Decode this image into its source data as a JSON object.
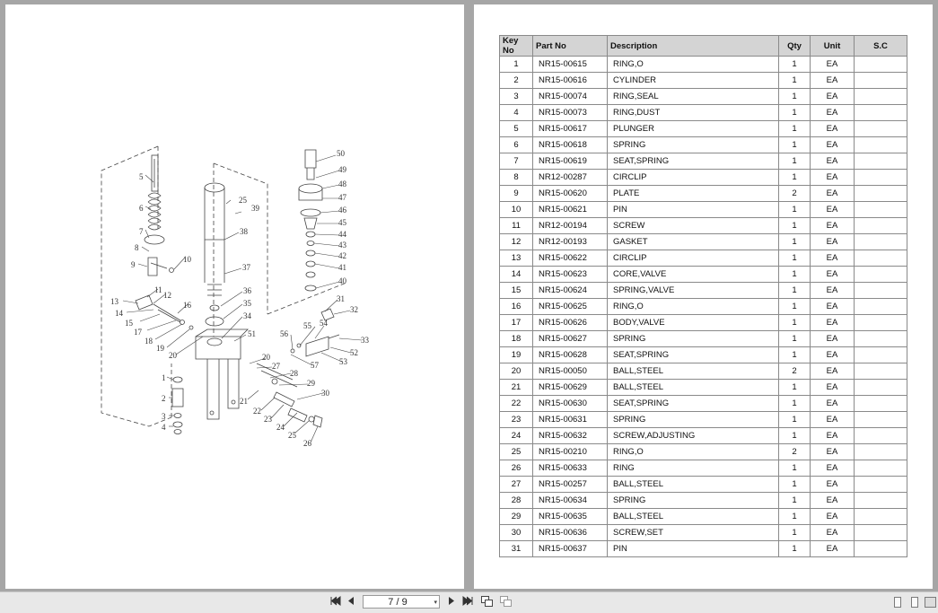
{
  "diagram": {
    "callouts": [
      "1",
      "2",
      "3",
      "4",
      "5",
      "6",
      "7",
      "8",
      "9",
      "10",
      "11",
      "12",
      "13",
      "14",
      "15",
      "16",
      "17",
      "18",
      "19",
      "20",
      "21",
      "22",
      "23",
      "24",
      "25",
      "26",
      "27",
      "28",
      "29",
      "30",
      "31",
      "32",
      "33",
      "34",
      "35",
      "36",
      "37",
      "38",
      "39",
      "40",
      "41",
      "42",
      "43",
      "44",
      "45",
      "46",
      "47",
      "48",
      "49",
      "50",
      "51",
      "52",
      "53",
      "54",
      "55",
      "56",
      "57",
      "20"
    ]
  },
  "table": {
    "headers": [
      "Key No",
      "Part No",
      "Description",
      "Qty",
      "Unit",
      "S.C"
    ],
    "rows": [
      [
        "1",
        "NR15-00615",
        "RING,O",
        "1",
        "EA",
        ""
      ],
      [
        "2",
        "NR15-00616",
        "CYLINDER",
        "1",
        "EA",
        ""
      ],
      [
        "3",
        "NR15-00074",
        "RING,SEAL",
        "1",
        "EA",
        ""
      ],
      [
        "4",
        "NR15-00073",
        "RING,DUST",
        "1",
        "EA",
        ""
      ],
      [
        "5",
        "NR15-00617",
        "PLUNGER",
        "1",
        "EA",
        ""
      ],
      [
        "6",
        "NR15-00618",
        "SPRING",
        "1",
        "EA",
        ""
      ],
      [
        "7",
        "NR15-00619",
        "SEAT,SPRING",
        "1",
        "EA",
        ""
      ],
      [
        "8",
        "NR12-00287",
        "CIRCLIP",
        "1",
        "EA",
        ""
      ],
      [
        "9",
        "NR15-00620",
        "PLATE",
        "2",
        "EA",
        ""
      ],
      [
        "10",
        "NR15-00621",
        "PIN",
        "1",
        "EA",
        ""
      ],
      [
        "11",
        "NR12-00194",
        "SCREW",
        "1",
        "EA",
        ""
      ],
      [
        "12",
        "NR12-00193",
        "GASKET",
        "1",
        "EA",
        ""
      ],
      [
        "13",
        "NR15-00622",
        "CIRCLIP",
        "1",
        "EA",
        ""
      ],
      [
        "14",
        "NR15-00623",
        "CORE,VALVE",
        "1",
        "EA",
        ""
      ],
      [
        "15",
        "NR15-00624",
        "SPRING,VALVE",
        "1",
        "EA",
        ""
      ],
      [
        "16",
        "NR15-00625",
        "RING,O",
        "1",
        "EA",
        ""
      ],
      [
        "17",
        "NR15-00626",
        "BODY,VALVE",
        "1",
        "EA",
        ""
      ],
      [
        "18",
        "NR15-00627",
        "SPRING",
        "1",
        "EA",
        ""
      ],
      [
        "19",
        "NR15-00628",
        "SEAT,SPRING",
        "1",
        "EA",
        ""
      ],
      [
        "20",
        "NR15-00050",
        "BALL,STEEL",
        "2",
        "EA",
        ""
      ],
      [
        "21",
        "NR15-00629",
        "BALL,STEEL",
        "1",
        "EA",
        ""
      ],
      [
        "22",
        "NR15-00630",
        "SEAT,SPRING",
        "1",
        "EA",
        ""
      ],
      [
        "23",
        "NR15-00631",
        "SPRING",
        "1",
        "EA",
        ""
      ],
      [
        "24",
        "NR15-00632",
        "SCREW,ADJUSTING",
        "1",
        "EA",
        ""
      ],
      [
        "25",
        "NR15-00210",
        "RING,O",
        "2",
        "EA",
        ""
      ],
      [
        "26",
        "NR15-00633",
        "RING",
        "1",
        "EA",
        ""
      ],
      [
        "27",
        "NR15-00257",
        "BALL,STEEL",
        "1",
        "EA",
        ""
      ],
      [
        "28",
        "NR15-00634",
        "SPRING",
        "1",
        "EA",
        ""
      ],
      [
        "29",
        "NR15-00635",
        "BALL,STEEL",
        "1",
        "EA",
        ""
      ],
      [
        "30",
        "NR15-00636",
        "SCREW,SET",
        "1",
        "EA",
        ""
      ],
      [
        "31",
        "NR15-00637",
        "PIN",
        "1",
        "EA",
        ""
      ]
    ]
  },
  "toolbar": {
    "page_indicator": "7 / 9",
    "icons": [
      "first-page-icon",
      "prev-page-icon",
      "next-page-icon",
      "last-page-icon",
      "copy-icon",
      "paste-icon",
      "single-page-icon",
      "continuous-icon",
      "facing-pages-icon"
    ]
  }
}
